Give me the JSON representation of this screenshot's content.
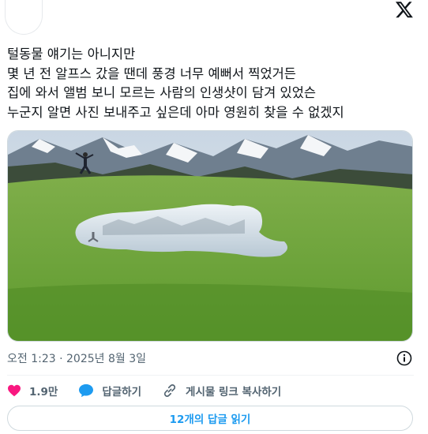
{
  "tweet": {
    "lines": [
      "털동물 얘기는 아니지만",
      "몇 년 전 알프스 갔을 땐데 풍경 너무 예뻐서 찍었거든",
      "집에 와서 앨범 보니 모르는 사람의 인생샷이 담겨 있었슨",
      "누군지 알면 사진 보내주고 싶은데 아마 영원히 찾을 수 없겠지"
    ],
    "timestamp": "오전 1:23 · 2025년 8월 3일"
  },
  "actions": {
    "likes": "1.9만",
    "reply": "답글하기",
    "copy_link": "게시물 링크 복사하기"
  },
  "replies_button": "12개의 답글 읽기",
  "colors": {
    "accent": "#1d9bf0",
    "like": "#f91880",
    "muted": "#536471"
  },
  "icons": [
    "x-logo-icon",
    "info-icon",
    "heart-icon",
    "reply-bubble-icon",
    "link-icon"
  ]
}
